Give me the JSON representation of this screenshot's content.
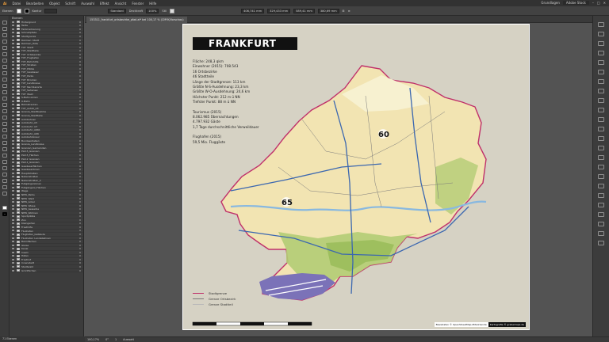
{
  "menubar": {
    "items": [
      "Datei",
      "Bearbeiten",
      "Objekt",
      "Schrift",
      "Auswahl",
      "Effekt",
      "Ansicht",
      "Fenster",
      "Hilfe"
    ],
    "workspace": "Grundlagen",
    "search_placeholder": "Adobe Stock"
  },
  "controlbar": {
    "selection_label": "Ebenen",
    "fill_color": "#ffffff",
    "stroke_color": "#000000",
    "stroke_label": "Kontur",
    "style_label": "Standard",
    "opacity_label": "Deckkraft",
    "opacity_value": "100%",
    "style2_label": "Stil",
    "x_value": "406,741 mm",
    "y_value": "329,433 mm",
    "w_value": "589,41 mm",
    "h_value": "380,69 mm"
  },
  "layers_panel": {
    "header": "Ebenen",
    "items": [
      "Hintergrund",
      "Texte",
      "Farbmarkierung",
      "Schnellpfeile",
      "Stadtgrenze",
      "Rahmen_Stadt",
      "Rahmen_Höfe",
      "TXT_Stadt",
      "TXT_Stadtteile",
      "TXT_Ortsbezirke",
      "TXT_Flughafen",
      "TXT_Bahnhöfe",
      "TXT_Straßen",
      "TXT_Plätze",
      "TXT_Gewässer",
      "TXT_Parks",
      "TXT_Brücken",
      "TXT_Landkreise",
      "TXT_Nachbarorte",
      "TXT_Sehensw",
      "TXT_Wald",
      "S-Bahn-Linien",
      "U-Bahn",
      "Bahnstrecken",
      "TXT_Autob_A3",
      "Grenze_Stadtbezirke",
      "Grenze_Stadtteile",
      "Autobahnen",
      "Autobahn_A5",
      "Autobahn_A3",
      "Autobahn_A661",
      "Autobahn_A66",
      "Autobahnkreuz",
      "Bundesstraßen",
      "Grenze_Landkreise",
      "Grenzen_Gemeinden",
      "PLZ-5_Grenzen",
      "PLZ-5_Flächen",
      "PLZ-2_Grenzen",
      "PLZ-1_Grenzen",
      "Gewässerflächen",
      "Gewässerlinien",
      "Hauptstraßen",
      "Nebenstraßen",
      "Nebenstraßen_2",
      "Fußgängerzonen",
      "Fußgängerz_Flächen",
      "Wege",
      "NEW_Parks",
      "NEW_Wald",
      "NEW_Acker",
      "NEW_Wiese",
      "NEW_Gewerbe",
      "NEW_Wohnen",
      "Sportplätze",
      "Zoo",
      "Kleingarten",
      "Friedhöfe",
      "Flughafen",
      "Flughafen_Gebäude",
      "Flughafen_Landebahnen",
      "Bahnflächen",
      "Gleise",
      "Kanal",
      "Inseln",
      "Häfen",
      "Friedhof",
      "Innenstadt",
      "Stadtwald",
      "Grünflächen"
    ],
    "status": "71 Ebenen"
  },
  "document_tab": {
    "title": "153311_frankfurt_ortsbezirke_pfad.ai* bei 100,17 % (CMYK/Vorschau)"
  },
  "status_bar": {
    "zoom": "100,17%",
    "angle": "0°",
    "page": "1",
    "tool": "Auswahl"
  },
  "map": {
    "title": "FRANKFURT",
    "stats": [
      "Fläche: 248,3 qkm",
      "Einwohner (2015): 708.543",
      "16 Ortsbezirke",
      "46 Stadtteile",
      "Länge der Stadtgrenze: 113 km",
      "Größte N-S-Ausdehnung: 23,3 km",
      "Größte W-O-Ausdehnung: 24,6 km",
      "Höchster Punkt: 212 m ü NN",
      "Tiefster Punkt: 88 m ü NN"
    ],
    "tourism": [
      "Tourismus (2015)",
      "8.062.985 Übernachtungen",
      "4.797.932 Gäste",
      "1,7 Tage durchschnittliche Verweildauer"
    ],
    "airport": [
      "Flughafen (2015)",
      "59,5 Mio. Fluggäste"
    ],
    "zip_labels": [
      "60",
      "65"
    ],
    "legend": [
      {
        "label": "Stadtgrenze",
        "color": "#c0306a"
      },
      {
        "label": "Grenze Ortsbezirk",
        "color": "#7a7a7a"
      },
      {
        "label": "Grenze Stadtteil",
        "color": "#b8b8b8"
      }
    ],
    "credits": [
      "Basisdaten © OpenStreetMap-Mitwirkende",
      "Kartografie © grebemaps.de"
    ],
    "colors": {
      "settlement": "#f2e4b2",
      "green": "#b3cc74",
      "agri": "#f7f1d0",
      "forest": "#9ebf5e",
      "water": "#88b8e0",
      "boundary": "#c0306a",
      "motorway": "#3b67b0",
      "airport": "#7b72b8",
      "title_bg": "#111111"
    }
  }
}
